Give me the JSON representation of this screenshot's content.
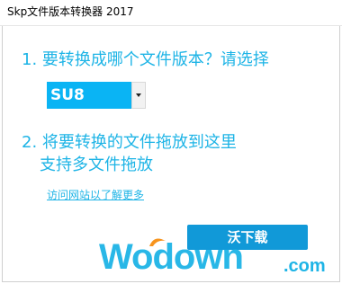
{
  "window": {
    "title": "Skp文件版本转换器 2017"
  },
  "steps": {
    "step1": "1. 要转换成哪个文件版本？请选择",
    "step2_line1": "2. 将要转换的文件拖放到这里",
    "step2_line2": "支持多文件拖放"
  },
  "version_select": {
    "selected": "SU8"
  },
  "link": {
    "label": "访问网站以了解更多"
  },
  "watermark": {
    "badge": "沃下载",
    "text": "Wodown",
    "suffix": ".com"
  },
  "colors": {
    "accent": "#1eb4e6",
    "select_bg": "#0ab4f4",
    "badge_bg": "#1199d8"
  }
}
